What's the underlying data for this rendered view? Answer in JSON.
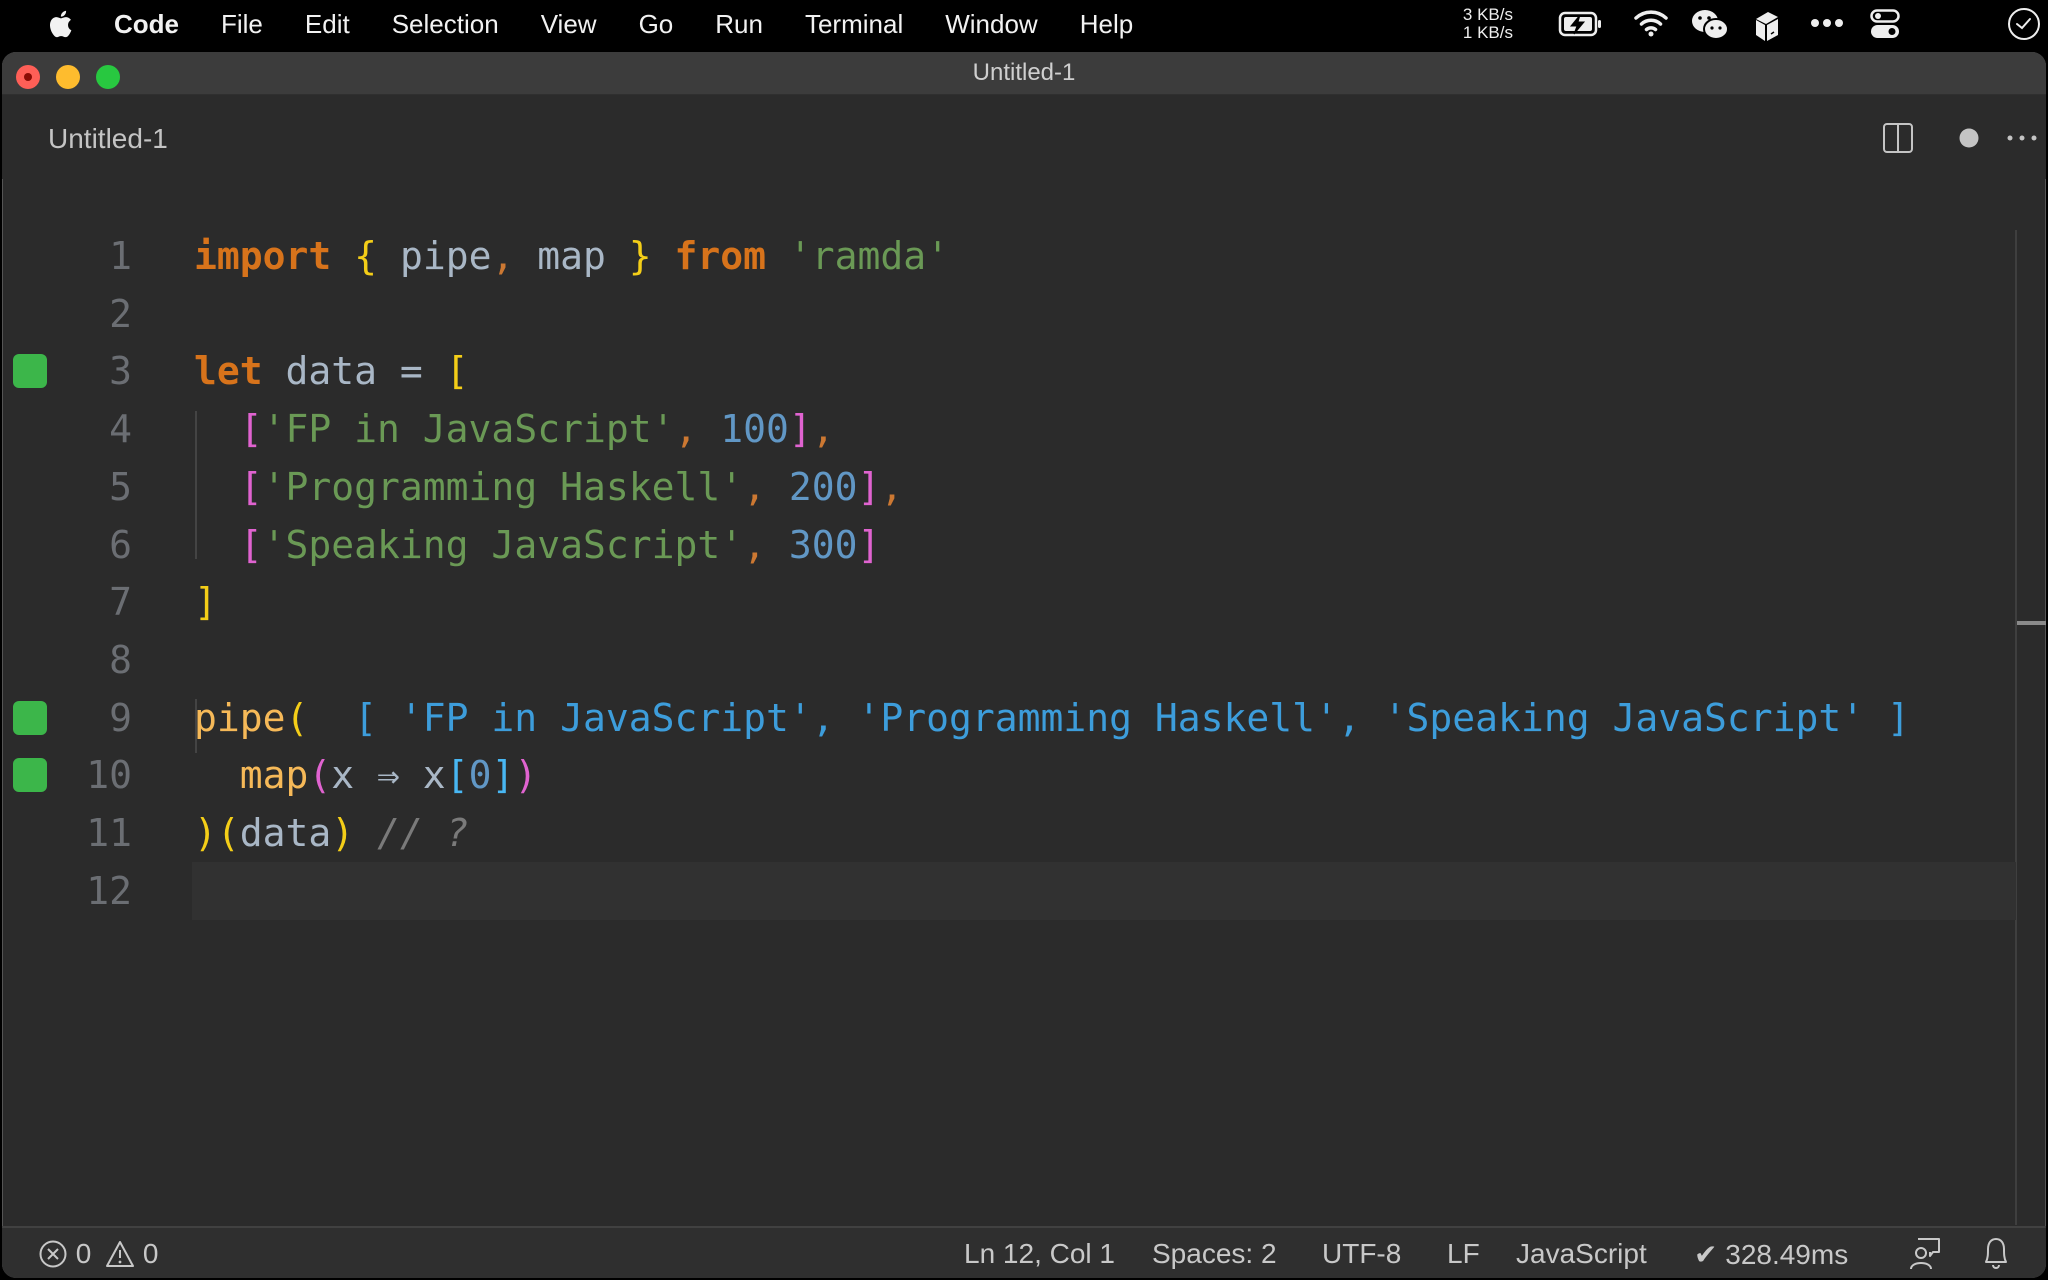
{
  "menubar": {
    "app_name": "Code",
    "menus": [
      "File",
      "Edit",
      "Selection",
      "View",
      "Go",
      "Run",
      "Terminal",
      "Window",
      "Help"
    ],
    "network": {
      "up": "3 KB/s",
      "down": "1 KB/s"
    },
    "tray_icons": [
      "battery-charging-icon",
      "wifi-icon",
      "wechat-icon",
      "package-icon",
      "more-icon",
      "control-center-icon",
      "clock-icon"
    ]
  },
  "window": {
    "title": "Untitled-1",
    "tab": {
      "title": "Untitled-1",
      "dirty": true
    },
    "tab_actions": [
      "split-editor-icon",
      "unsaved-dot-icon",
      "more-actions-icon"
    ]
  },
  "editor": {
    "current_line": 12,
    "lines": [
      {
        "n": "1",
        "marker": false,
        "tokens": [
          {
            "t": "import",
            "c": "kw"
          },
          {
            "t": " ",
            "c": "id"
          },
          {
            "t": "{",
            "c": "br1"
          },
          {
            "t": " pipe",
            "c": "id"
          },
          {
            "t": ",",
            "c": "punc"
          },
          {
            "t": " map ",
            "c": "id"
          },
          {
            "t": "}",
            "c": "br1"
          },
          {
            "t": " ",
            "c": "id"
          },
          {
            "t": "from",
            "c": "kw"
          },
          {
            "t": " ",
            "c": "id"
          },
          {
            "t": "'ramda'",
            "c": "str"
          }
        ]
      },
      {
        "n": "2",
        "marker": false,
        "tokens": []
      },
      {
        "n": "3",
        "marker": true,
        "tokens": [
          {
            "t": "let",
            "c": "kw"
          },
          {
            "t": " data = ",
            "c": "id"
          },
          {
            "t": "[",
            "c": "br1"
          }
        ]
      },
      {
        "n": "4",
        "marker": false,
        "tokens": [
          {
            "t": "  ",
            "c": "id"
          },
          {
            "t": "[",
            "c": "br2"
          },
          {
            "t": "'FP in JavaScript'",
            "c": "str"
          },
          {
            "t": ",",
            "c": "punc"
          },
          {
            "t": " ",
            "c": "id"
          },
          {
            "t": "100",
            "c": "num"
          },
          {
            "t": "]",
            "c": "br2"
          },
          {
            "t": ",",
            "c": "punc"
          }
        ]
      },
      {
        "n": "5",
        "marker": false,
        "tokens": [
          {
            "t": "  ",
            "c": "id"
          },
          {
            "t": "[",
            "c": "br2"
          },
          {
            "t": "'Programming Haskell'",
            "c": "str"
          },
          {
            "t": ",",
            "c": "punc"
          },
          {
            "t": " ",
            "c": "id"
          },
          {
            "t": "200",
            "c": "num"
          },
          {
            "t": "]",
            "c": "br2"
          },
          {
            "t": ",",
            "c": "punc"
          }
        ]
      },
      {
        "n": "6",
        "marker": false,
        "tokens": [
          {
            "t": "  ",
            "c": "id"
          },
          {
            "t": "[",
            "c": "br2"
          },
          {
            "t": "'Speaking JavaScript'",
            "c": "str"
          },
          {
            "t": ",",
            "c": "punc"
          },
          {
            "t": " ",
            "c": "id"
          },
          {
            "t": "300",
            "c": "num"
          },
          {
            "t": "]",
            "c": "br2"
          }
        ]
      },
      {
        "n": "7",
        "marker": false,
        "tokens": [
          {
            "t": "]",
            "c": "br1"
          }
        ]
      },
      {
        "n": "8",
        "marker": false,
        "tokens": []
      },
      {
        "n": "9",
        "marker": true,
        "tokens": [
          {
            "t": "pipe",
            "c": "fn"
          },
          {
            "t": "(",
            "c": "br1"
          },
          {
            "t": "  [ 'FP in JavaScript', 'Programming Haskell', 'Speaking JavaScript' ]",
            "c": "res"
          }
        ]
      },
      {
        "n": "10",
        "marker": true,
        "tokens": [
          {
            "t": "  ",
            "c": "id"
          },
          {
            "t": "map",
            "c": "fn"
          },
          {
            "t": "(",
            "c": "br2"
          },
          {
            "t": "x ⇒ x",
            "c": "id"
          },
          {
            "t": "[",
            "c": "br3"
          },
          {
            "t": "0",
            "c": "num"
          },
          {
            "t": "]",
            "c": "br3"
          },
          {
            "t": ")",
            "c": "br2"
          }
        ]
      },
      {
        "n": "11",
        "marker": false,
        "tokens": [
          {
            "t": ")",
            "c": "br1"
          },
          {
            "t": "(",
            "c": "br1"
          },
          {
            "t": "data",
            "c": "id"
          },
          {
            "t": ")",
            "c": "br1"
          },
          {
            "t": " ",
            "c": "id"
          },
          {
            "t": "// ?",
            "c": "cm"
          }
        ]
      },
      {
        "n": "12",
        "marker": false,
        "tokens": []
      }
    ]
  },
  "statusbar": {
    "errors": "0",
    "warnings": "0",
    "cursor": "Ln 12, Col 1",
    "indent": "Spaces: 2",
    "encoding": "UTF-8",
    "eol": "LF",
    "language": "JavaScript",
    "quokka_timing": "✔ 328.49ms"
  },
  "colors": {
    "editor_bg": "#2b2b2b",
    "titlebar_bg": "#3c3c3c",
    "statusbar_bg": "#2f2f2f",
    "gutter_marker": "#3cb64a",
    "keyword": "#d7731b",
    "string": "#6a9955",
    "number": "#6197c5",
    "result": "#3d9ddb"
  }
}
